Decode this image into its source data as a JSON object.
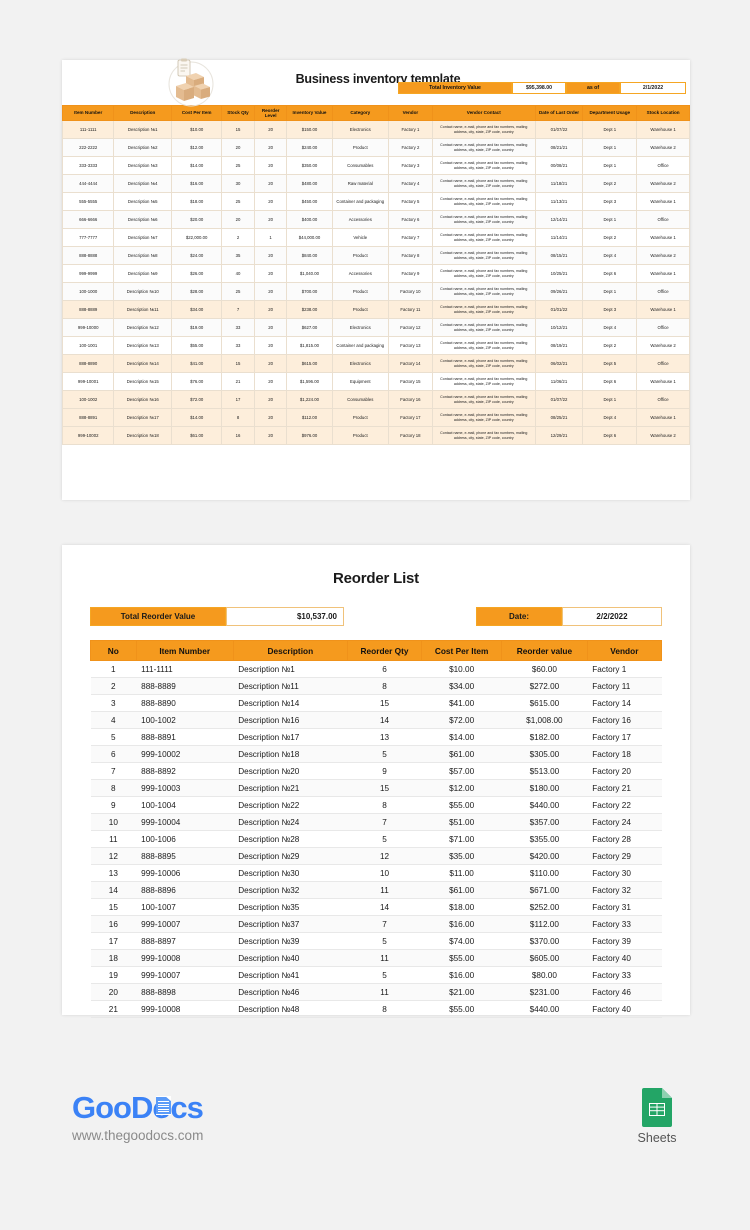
{
  "inventory": {
    "title": "Business inventory template",
    "icon": "boxes-clipboard-icon",
    "summary": {
      "total_label": "Total Inventory Value",
      "total_value": "$95,398.00",
      "asof_label": "as of",
      "asof_date": "2/1/2022"
    },
    "columns": [
      "Item Number",
      "Description",
      "Cost Per Item",
      "Stock Qty",
      "Reorder Level",
      "Inventory Value",
      "Category",
      "Vendor",
      "Vendor Contact",
      "Date of Last Order",
      "Department Usage",
      "Stock Location"
    ],
    "vendor_contact_text": "Contact name, e-mail, phone and fax numbers, mailing address, city, state, ZIP code, country",
    "rows": [
      {
        "item": "111-1111",
        "desc": "Description №1",
        "cost": "$10.00",
        "qty": "15",
        "reorder": "20",
        "value": "$150.00",
        "cat": "Electronics",
        "vendor": "Factory 1",
        "date": "01/07/22",
        "dept": "Dept 1",
        "loc": "Warehouse 1",
        "hl": true
      },
      {
        "item": "222-2222",
        "desc": "Description №2",
        "cost": "$12.00",
        "qty": "20",
        "reorder": "20",
        "value": "$240.00",
        "cat": "Product",
        "vendor": "Factory 2",
        "date": "08/21/21",
        "dept": "Dept 1",
        "loc": "Warehouse 2",
        "hl": false
      },
      {
        "item": "333-3333",
        "desc": "Description №3",
        "cost": "$14.00",
        "qty": "25",
        "reorder": "20",
        "value": "$350.00",
        "cat": "Consumables",
        "vendor": "Factory 3",
        "date": "00/08/21",
        "dept": "Dept 1",
        "loc": "Office",
        "hl": false
      },
      {
        "item": "444-4444",
        "desc": "Description №4",
        "cost": "$16.00",
        "qty": "30",
        "reorder": "20",
        "value": "$480.00",
        "cat": "Raw material",
        "vendor": "Factory 4",
        "date": "11/18/21",
        "dept": "Dept 2",
        "loc": "Warehouse 2",
        "hl": false
      },
      {
        "item": "555-5555",
        "desc": "Description №5",
        "cost": "$18.00",
        "qty": "25",
        "reorder": "20",
        "value": "$450.00",
        "cat": "Container and packaging",
        "vendor": "Factory 5",
        "date": "11/13/21",
        "dept": "Dept 3",
        "loc": "Warehouse 1",
        "hl": false
      },
      {
        "item": "666-6666",
        "desc": "Description №6",
        "cost": "$20.00",
        "qty": "20",
        "reorder": "20",
        "value": "$400.00",
        "cat": "Accessories",
        "vendor": "Factory 6",
        "date": "12/14/21",
        "dept": "Dept 1",
        "loc": "Office",
        "hl": false
      },
      {
        "item": "777-7777",
        "desc": "Description №7",
        "cost": "$22,000.00",
        "qty": "2",
        "reorder": "1",
        "value": "$44,000.00",
        "cat": "Vehicle",
        "vendor": "Factory 7",
        "date": "11/14/21",
        "dept": "Dept 2",
        "loc": "Warehouse 1",
        "hl": false
      },
      {
        "item": "888-8888",
        "desc": "Description №8",
        "cost": "$24.00",
        "qty": "35",
        "reorder": "20",
        "value": "$840.00",
        "cat": "Product",
        "vendor": "Factory 8",
        "date": "08/15/21",
        "dept": "Dept 4",
        "loc": "Warehouse 2",
        "hl": false
      },
      {
        "item": "999-9999",
        "desc": "Description №9",
        "cost": "$26.00",
        "qty": "40",
        "reorder": "20",
        "value": "$1,040.00",
        "cat": "Accessories",
        "vendor": "Factory 9",
        "date": "10/25/21",
        "dept": "Dept 6",
        "loc": "Warehouse 1",
        "hl": false
      },
      {
        "item": "100-1000",
        "desc": "Description №10",
        "cost": "$28.00",
        "qty": "25",
        "reorder": "20",
        "value": "$700.00",
        "cat": "Product",
        "vendor": "Factory 10",
        "date": "09/26/21",
        "dept": "Dept 1",
        "loc": "Office",
        "hl": false
      },
      {
        "item": "888-8889",
        "desc": "Description №11",
        "cost": "$34.00",
        "qty": "7",
        "reorder": "20",
        "value": "$238.00",
        "cat": "Product",
        "vendor": "Factory 11",
        "date": "01/01/22",
        "dept": "Dept 3",
        "loc": "Warehouse 1",
        "hl": true
      },
      {
        "item": "999-10000",
        "desc": "Description №12",
        "cost": "$19.00",
        "qty": "33",
        "reorder": "20",
        "value": "$627.00",
        "cat": "Electronics",
        "vendor": "Factory 12",
        "date": "10/12/21",
        "dept": "Dept 4",
        "loc": "Office",
        "hl": false
      },
      {
        "item": "100-1001",
        "desc": "Description №13",
        "cost": "$55.00",
        "qty": "33",
        "reorder": "20",
        "value": "$1,815.00",
        "cat": "Container and packaging",
        "vendor": "Factory 13",
        "date": "08/19/21",
        "dept": "Dept 2",
        "loc": "Warehouse 2",
        "hl": false
      },
      {
        "item": "888-8890",
        "desc": "Description №14",
        "cost": "$41.00",
        "qty": "15",
        "reorder": "20",
        "value": "$615.00",
        "cat": "Electronics",
        "vendor": "Factory 14",
        "date": "06/02/21",
        "dept": "Dept 5",
        "loc": "Office",
        "hl": true
      },
      {
        "item": "999-10001",
        "desc": "Description №15",
        "cost": "$76.00",
        "qty": "21",
        "reorder": "20",
        "value": "$1,596.00",
        "cat": "Equipment",
        "vendor": "Factory 15",
        "date": "11/06/21",
        "dept": "Dept 6",
        "loc": "Warehouse 1",
        "hl": false
      },
      {
        "item": "100-1002",
        "desc": "Description №16",
        "cost": "$72.00",
        "qty": "17",
        "reorder": "20",
        "value": "$1,224.00",
        "cat": "Consumables",
        "vendor": "Factory 16",
        "date": "01/07/22",
        "dept": "Dept 1",
        "loc": "Office",
        "hl": true
      },
      {
        "item": "888-8891",
        "desc": "Description №17",
        "cost": "$14.00",
        "qty": "8",
        "reorder": "20",
        "value": "$112.00",
        "cat": "Product",
        "vendor": "Factory 17",
        "date": "08/25/21",
        "dept": "Dept 4",
        "loc": "Warehouse 1",
        "hl": true
      },
      {
        "item": "999-10002",
        "desc": "Description №18",
        "cost": "$61.00",
        "qty": "16",
        "reorder": "20",
        "value": "$976.00",
        "cat": "Product",
        "vendor": "Factory 18",
        "date": "12/29/21",
        "dept": "Dept 6",
        "loc": "Warehouse 2",
        "hl": true
      }
    ]
  },
  "reorder": {
    "title": "Reorder List",
    "summary": {
      "total_label": "Total Reorder Value",
      "total_value": "$10,537.00",
      "date_label": "Date:",
      "date_value": "2/2/2022"
    },
    "columns": [
      "No",
      "Item Number",
      "Description",
      "Reorder Qty",
      "Cost Per Item",
      "Reorder value",
      "Vendor"
    ],
    "rows": [
      {
        "no": "1",
        "item": "111-1111",
        "desc": "Description №1",
        "qty": "6",
        "cost": "$10.00",
        "value": "$60.00",
        "vendor": "Factory 1"
      },
      {
        "no": "2",
        "item": "888-8889",
        "desc": "Description №11",
        "qty": "8",
        "cost": "$34.00",
        "value": "$272.00",
        "vendor": "Factory 11"
      },
      {
        "no": "3",
        "item": "888-8890",
        "desc": "Description №14",
        "qty": "15",
        "cost": "$41.00",
        "value": "$615.00",
        "vendor": "Factory 14"
      },
      {
        "no": "4",
        "item": "100-1002",
        "desc": "Description №16",
        "qty": "14",
        "cost": "$72.00",
        "value": "$1,008.00",
        "vendor": "Factory 16"
      },
      {
        "no": "5",
        "item": "888-8891",
        "desc": "Description №17",
        "qty": "13",
        "cost": "$14.00",
        "value": "$182.00",
        "vendor": "Factory 17"
      },
      {
        "no": "6",
        "item": "999-10002",
        "desc": "Description №18",
        "qty": "5",
        "cost": "$61.00",
        "value": "$305.00",
        "vendor": "Factory 18"
      },
      {
        "no": "7",
        "item": "888-8892",
        "desc": "Description №20",
        "qty": "9",
        "cost": "$57.00",
        "value": "$513.00",
        "vendor": "Factory 20"
      },
      {
        "no": "8",
        "item": "999-10003",
        "desc": "Description №21",
        "qty": "15",
        "cost": "$12.00",
        "value": "$180.00",
        "vendor": "Factory 21"
      },
      {
        "no": "9",
        "item": "100-1004",
        "desc": "Description №22",
        "qty": "8",
        "cost": "$55.00",
        "value": "$440.00",
        "vendor": "Factory 22"
      },
      {
        "no": "10",
        "item": "999-10004",
        "desc": "Description №24",
        "qty": "7",
        "cost": "$51.00",
        "value": "$357.00",
        "vendor": "Factory 24"
      },
      {
        "no": "11",
        "item": "100-1006",
        "desc": "Description №28",
        "qty": "5",
        "cost": "$71.00",
        "value": "$355.00",
        "vendor": "Factory 28"
      },
      {
        "no": "12",
        "item": "888-8895",
        "desc": "Description №29",
        "qty": "12",
        "cost": "$35.00",
        "value": "$420.00",
        "vendor": "Factory 29"
      },
      {
        "no": "13",
        "item": "999-10006",
        "desc": "Description №30",
        "qty": "10",
        "cost": "$11.00",
        "value": "$110.00",
        "vendor": "Factory 30"
      },
      {
        "no": "14",
        "item": "888-8896",
        "desc": "Description №32",
        "qty": "11",
        "cost": "$61.00",
        "value": "$671.00",
        "vendor": "Factory 32"
      },
      {
        "no": "15",
        "item": "100-1007",
        "desc": "Description №35",
        "qty": "14",
        "cost": "$18.00",
        "value": "$252.00",
        "vendor": "Factory 31"
      },
      {
        "no": "16",
        "item": "999-10007",
        "desc": "Description №37",
        "qty": "7",
        "cost": "$16.00",
        "value": "$112.00",
        "vendor": "Factory 33"
      },
      {
        "no": "17",
        "item": "888-8897",
        "desc": "Description №39",
        "qty": "5",
        "cost": "$74.00",
        "value": "$370.00",
        "vendor": "Factory 39"
      },
      {
        "no": "18",
        "item": "999-10008",
        "desc": "Description №40",
        "qty": "11",
        "cost": "$55.00",
        "value": "$605.00",
        "vendor": "Factory 40"
      },
      {
        "no": "19",
        "item": "999-10007",
        "desc": "Description №41",
        "qty": "5",
        "cost": "$16.00",
        "value": "$80.00",
        "vendor": "Factory 33"
      },
      {
        "no": "20",
        "item": "888-8898",
        "desc": "Description №46",
        "qty": "11",
        "cost": "$21.00",
        "value": "$231.00",
        "vendor": "Factory 46"
      },
      {
        "no": "21",
        "item": "999-10008",
        "desc": "Description №48",
        "qty": "8",
        "cost": "$55.00",
        "value": "$440.00",
        "vendor": "Factory 40"
      }
    ]
  },
  "footer": {
    "brand_goo": "Goo",
    "brand_docs": "Docs",
    "url": "www.thegoodocs.com",
    "sheets_label": "Sheets"
  },
  "colors": {
    "accent": "#f59a1e",
    "highlight_row": "#fdeedb",
    "brand_blue": "#3b82f6",
    "sheets_green": "#23a566"
  }
}
